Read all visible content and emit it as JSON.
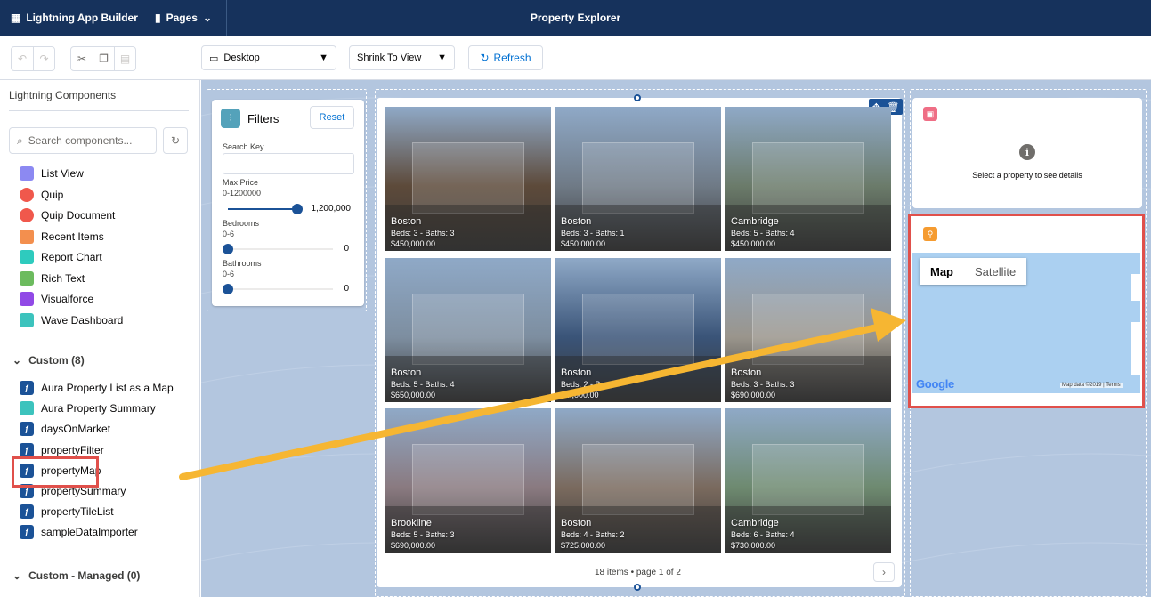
{
  "topbar": {
    "app": "Lightning App Builder",
    "pages": "Pages",
    "title": "Property Explorer"
  },
  "toolbar": {
    "device": "Desktop",
    "zoom": "Shrink To View",
    "refresh": "Refresh"
  },
  "sidebar": {
    "title": "Lightning Components",
    "search_placeholder": "Search components...",
    "standard": [
      {
        "label": "List View",
        "icon": "list-view-icon",
        "color": "#8c89f2"
      },
      {
        "label": "Quip",
        "icon": "quip-icon",
        "color": "#f0584c"
      },
      {
        "label": "Quip Document",
        "icon": "quip-document-icon",
        "color": "#f0584c"
      },
      {
        "label": "Recent Items",
        "icon": "recent-items-icon",
        "color": "#f38f4e"
      },
      {
        "label": "Report Chart",
        "icon": "report-chart-icon",
        "color": "#2ecbbe"
      },
      {
        "label": "Rich Text",
        "icon": "rich-text-icon",
        "color": "#6cbb5e"
      },
      {
        "label": "Visualforce",
        "icon": "visualforce-icon",
        "color": "#9149e6"
      },
      {
        "label": "Wave Dashboard",
        "icon": "wave-dashboard-icon",
        "color": "#3cc3bd"
      }
    ],
    "custom_header": "Custom (8)",
    "custom": [
      {
        "label": "Aura Property List as a Map",
        "icon": "lightning-icon",
        "color": "#1b5297"
      },
      {
        "label": "Aura Property Summary",
        "icon": "home-icon",
        "color": "#3cc3bd"
      },
      {
        "label": "daysOnMarket",
        "icon": "lightning-icon",
        "color": "#1b5297"
      },
      {
        "label": "propertyFilter",
        "icon": "lightning-icon",
        "color": "#1b5297"
      },
      {
        "label": "propertyMap",
        "icon": "lightning-icon",
        "color": "#1b5297"
      },
      {
        "label": "propertySummary",
        "icon": "lightning-icon",
        "color": "#1b5297"
      },
      {
        "label": "propertyTileList",
        "icon": "lightning-icon",
        "color": "#1b5297"
      },
      {
        "label": "sampleDataImporter",
        "icon": "lightning-icon",
        "color": "#1b5297"
      }
    ],
    "managed_header": "Custom - Managed (0)"
  },
  "filters": {
    "title": "Filters",
    "reset": "Reset",
    "search_label": "Search Key",
    "price_label": "Max Price",
    "price_range": "0-1200000",
    "price_value": "1,200,000",
    "price_fraction": 1,
    "bed_label": "Bedrooms",
    "bed_range": "0-6",
    "bed_value": "0",
    "bed_fraction": 0,
    "bath_label": "Bathrooms",
    "bath_range": "0-6",
    "bath_value": "0",
    "bath_fraction": 0
  },
  "tiles": [
    {
      "city": "Boston",
      "beds": "Beds: 3 - Baths: 3",
      "price": "$450,000.00",
      "bg": "#5d4a3a"
    },
    {
      "city": "Boston",
      "beds": "Beds: 3 - Baths: 1",
      "price": "$450,000.00",
      "bg": "#6f7a86"
    },
    {
      "city": "Cambridge",
      "beds": "Beds: 5 - Baths: 4",
      "price": "$450,000.00",
      "bg": "#6b7b6a"
    },
    {
      "city": "Boston",
      "beds": "Beds: 5 - Baths: 4",
      "price": "$650,000.00",
      "bg": "#7d8ea0"
    },
    {
      "city": "Boston",
      "beds": "Beds: 2 - B...",
      "price": "$...,000.00",
      "bg": "#3a5478"
    },
    {
      "city": "Boston",
      "beds": "Beds: 3 - Baths: 3",
      "price": "$690,000.00",
      "bg": "#9a958c"
    },
    {
      "city": "Brookline",
      "beds": "Beds: 5 - Baths: 3",
      "price": "$690,000.00",
      "bg": "#8a7a80"
    },
    {
      "city": "Boston",
      "beds": "Beds: 4 - Baths: 2",
      "price": "$725,000.00",
      "bg": "#7a6a5e"
    },
    {
      "city": "Cambridge",
      "beds": "Beds: 6 - Baths: 4",
      "price": "$730,000.00",
      "bg": "#6e8a70"
    }
  ],
  "pager": "18 items • page 1 of 2",
  "summary": {
    "text": "Select a property to see details"
  },
  "map": {
    "map_tab": "Map",
    "satellite_tab": "Satellite",
    "logo": "Google",
    "attribution": "Map data ©2019 | Terms"
  },
  "colors": {
    "header": "#16325c",
    "canvas": "#b3c6df",
    "highlight": "#e0504b",
    "arrow": "#f6b632"
  }
}
